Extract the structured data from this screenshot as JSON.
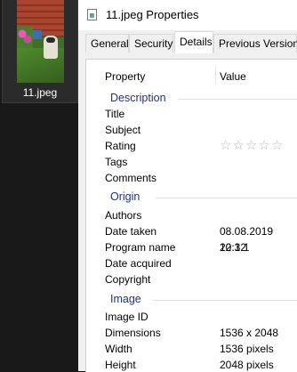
{
  "explorer": {
    "file_label": "11.jpeg"
  },
  "dialog": {
    "title": "11.jpeg Properties",
    "tabs": [
      "General",
      "Security",
      "Details",
      "Previous Versions"
    ],
    "active_tab": "Details",
    "columns": {
      "property": "Property",
      "value": "Value"
    },
    "groups": {
      "description": {
        "label": "Description",
        "rows": [
          {
            "property": "Title",
            "value": ""
          },
          {
            "property": "Subject",
            "value": ""
          },
          {
            "property": "Rating",
            "value": "",
            "stars_filled": 0,
            "stars_total": 5
          },
          {
            "property": "Tags",
            "value": ""
          },
          {
            "property": "Comments",
            "value": ""
          }
        ]
      },
      "origin": {
        "label": "Origin",
        "rows": [
          {
            "property": "Authors",
            "value": ""
          },
          {
            "property": "Date taken",
            "value": "08.08.2019 20:12"
          },
          {
            "property": "Program name",
            "value": "12.3.1"
          },
          {
            "property": "Date acquired",
            "value": ""
          },
          {
            "property": "Copyright",
            "value": ""
          }
        ]
      },
      "image": {
        "label": "Image",
        "rows": [
          {
            "property": "Image ID",
            "value": ""
          },
          {
            "property": "Dimensions",
            "value": "1536 x 2048"
          },
          {
            "property": "Width",
            "value": "1536 pixels"
          },
          {
            "property": "Height",
            "value": "2048 pixels"
          }
        ]
      }
    }
  },
  "colors": {
    "group_heading": "#1e3287",
    "dark_background": "#191919"
  },
  "icons": {
    "file": "image-file-icon",
    "rating": "star-icon"
  }
}
